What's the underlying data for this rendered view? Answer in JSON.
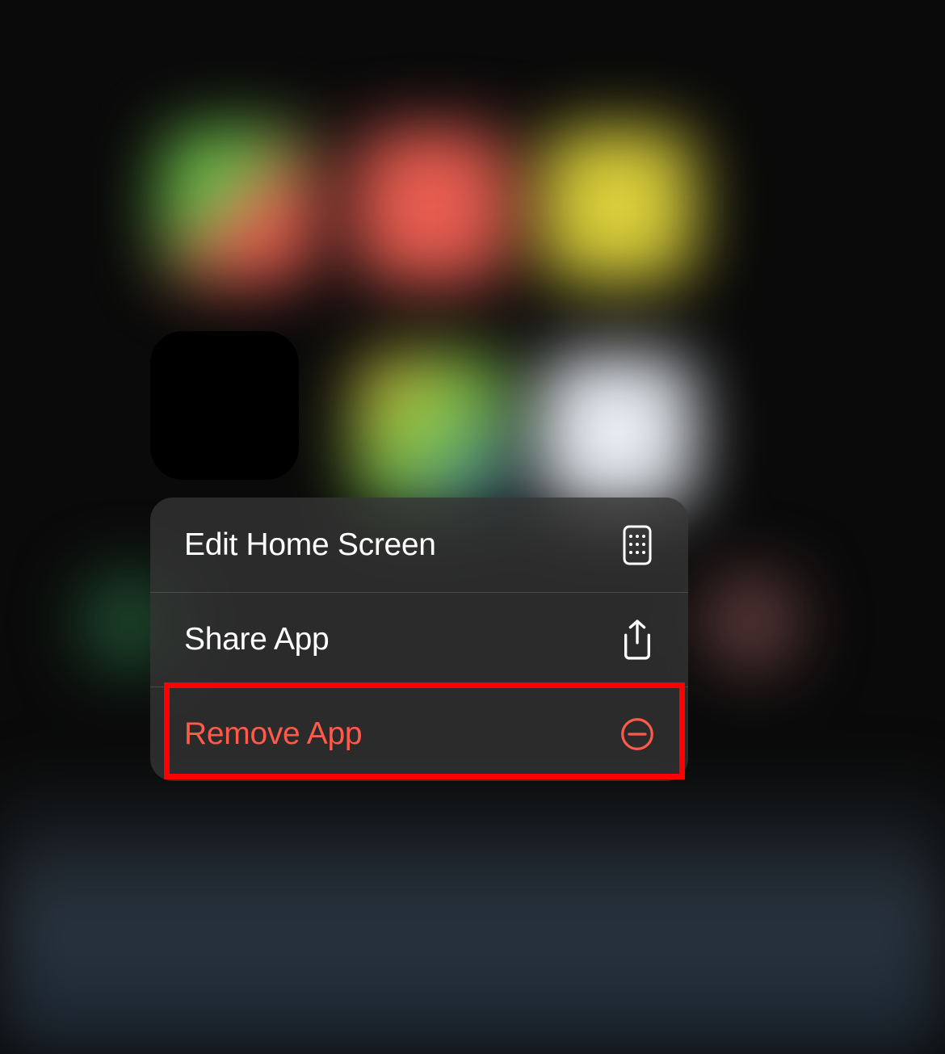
{
  "context_menu": {
    "items": [
      {
        "label": "Edit Home Screen",
        "icon": "home-screen-icon",
        "destructive": false
      },
      {
        "label": "Share App",
        "icon": "share-icon",
        "destructive": false
      },
      {
        "label": "Remove App",
        "icon": "remove-icon",
        "destructive": true
      }
    ]
  },
  "highlight": {
    "target": "remove-app-menu-item"
  }
}
